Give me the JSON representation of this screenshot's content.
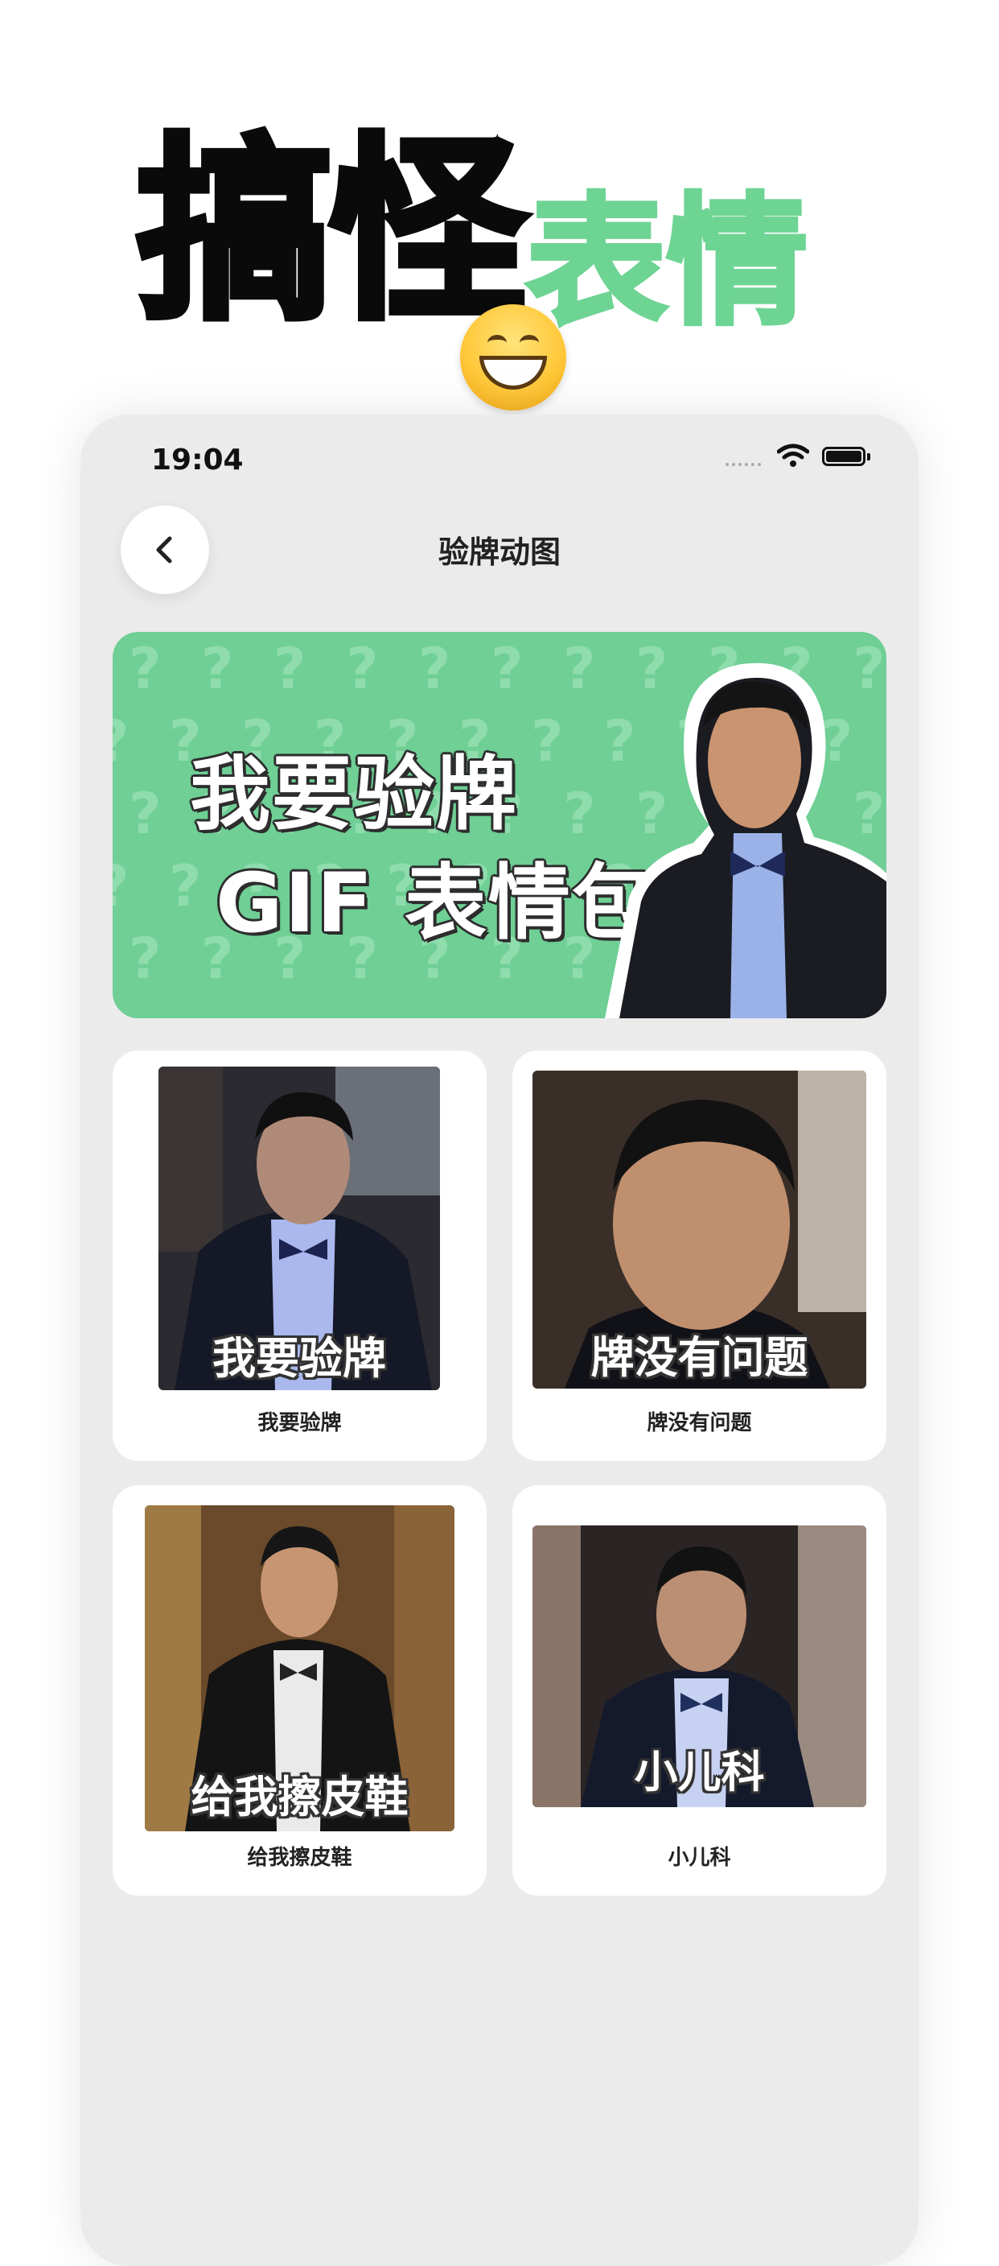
{
  "promo": {
    "title_black": "搞怪",
    "title_green": "表情",
    "emoji_icon": "grinning-face-icon"
  },
  "status_bar": {
    "time": "19:04"
  },
  "nav": {
    "title": "验牌动图",
    "back_icon": "chevron-left-icon"
  },
  "banner": {
    "line1": "我要验牌",
    "line2": "GIF 表情包",
    "background_color": "#6fcf95"
  },
  "stickers": [
    {
      "caption": "我要验牌",
      "label": "我要验牌"
    },
    {
      "caption": "牌没有问题",
      "label": "牌没有问题"
    },
    {
      "caption": "给我擦皮鞋",
      "label": "给我擦皮鞋"
    },
    {
      "caption": "小儿科",
      "label": "小儿科"
    }
  ],
  "colors": {
    "accent_green": "#6ed494",
    "phone_background": "#ebebeb"
  }
}
